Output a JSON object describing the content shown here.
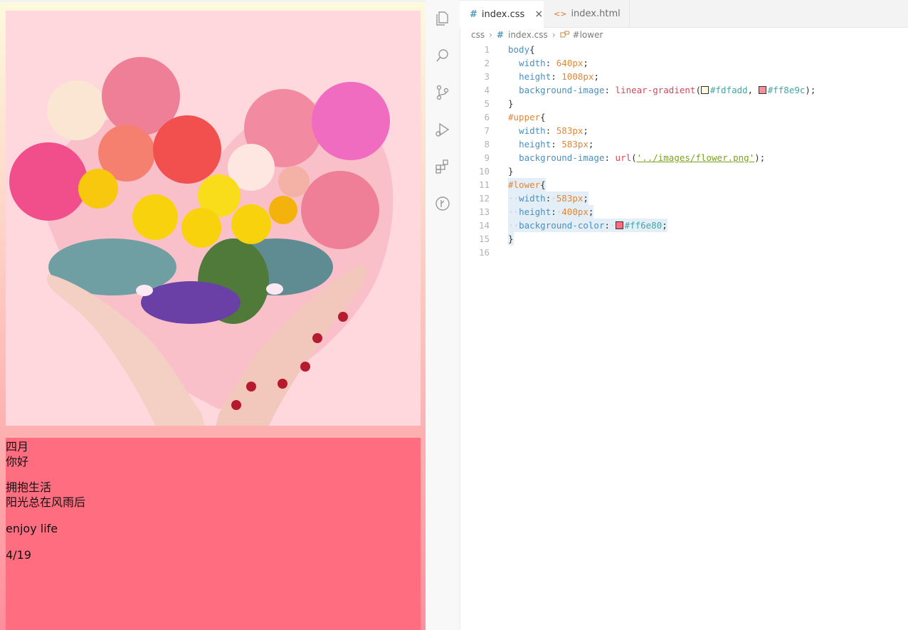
{
  "preview": {
    "lower_lines": [
      "四月",
      "你好",
      "拥抱生活",
      "阳光总在风雨后",
      "enjoy life",
      "4/19"
    ]
  },
  "editor": {
    "tabs": [
      {
        "icon": "#",
        "label": "index.css",
        "close": "×"
      },
      {
        "icon": "<>",
        "label": "index.html"
      }
    ],
    "breadcrumb": {
      "folder": "css",
      "file_icon": "#",
      "file": "index.css",
      "symbol": "#lower"
    },
    "line_numbers": [
      "1",
      "2",
      "3",
      "4",
      "5",
      "6",
      "7",
      "8",
      "9",
      "10",
      "11",
      "12",
      "13",
      "14",
      "15",
      "16"
    ],
    "code": {
      "l1_sel": "body",
      "l1_brace": "{",
      "l2_prop": "width",
      "l2_val": "640px",
      "l3_prop": "height",
      "l3_val": "1008px",
      "l4_prop": "background-image",
      "l4_fn": "linear-gradient",
      "l4_c1": "#fdfadd",
      "l4_c2": "#ff8e9c",
      "l5": "}",
      "l6_sel": "#upper",
      "l6_brace": "{",
      "l7_prop": "width",
      "l7_val": "583px",
      "l8_prop": "height",
      "l8_val": "583px",
      "l9_prop": "background-image",
      "l9_fn": "url",
      "l9_str": "'../images/flower.png'",
      "l10": "}",
      "l11_sel": "#lower",
      "l11_brace": "{",
      "l12_prop": "width",
      "l12_val": "583px",
      "l13_prop": "height",
      "l13_val": "400px",
      "l14_prop": "background-color",
      "l14_c": "#ff6e80",
      "l15": "}"
    }
  },
  "colors": {
    "gradient_top": "#fdfadd",
    "gradient_bottom": "#ff8e9c",
    "upper_bg": "#ffd8de",
    "lower_bg": "#ff6e80",
    "swatch_1": "#fdfadd",
    "swatch_2": "#ff8e9c",
    "swatch_3": "#ff6e80"
  }
}
